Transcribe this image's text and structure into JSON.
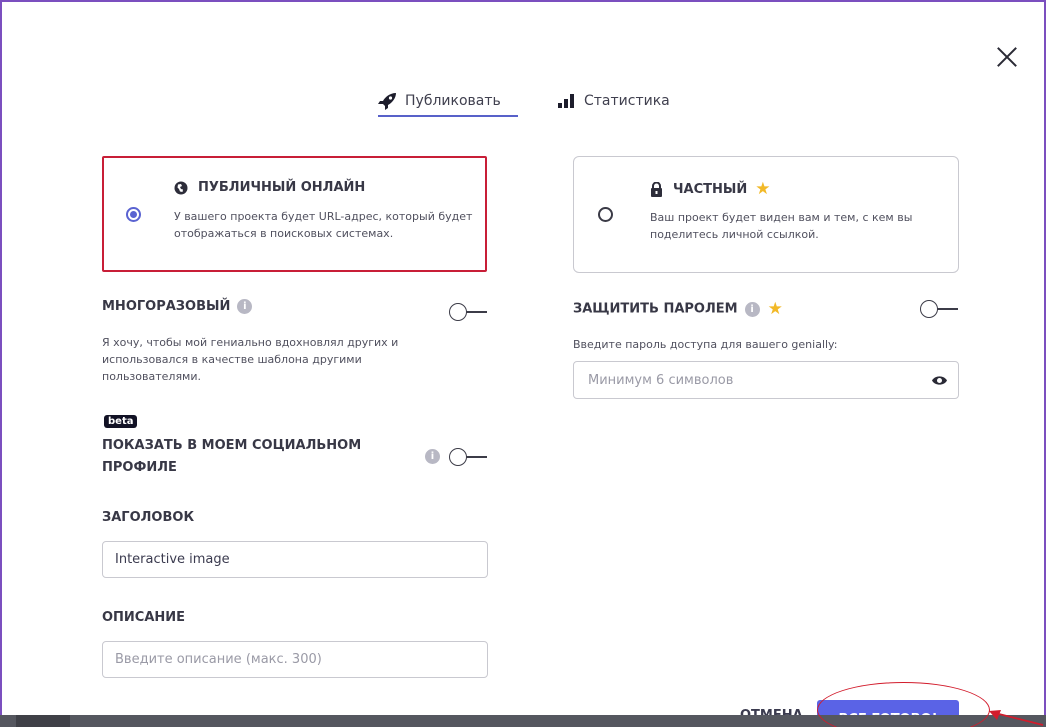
{
  "tabs": {
    "publish": "Публиковать",
    "stats": "Статистика"
  },
  "visibility": {
    "public": {
      "title": "ПУБЛИЧНЫЙ ОНЛАЙН",
      "description": "У вашего проекта будет URL-адрес, который будет отображаться в поисковых системах.",
      "selected": true
    },
    "private": {
      "title": "ЧАСТНЫЙ",
      "description": "Ваш проект будет виден вам и тем, с кем вы поделитесь личной ссылкой.",
      "selected": false
    }
  },
  "reusable": {
    "label": "МНОГОРАЗОВЫЙ",
    "description": "Я хочу, чтобы мой гениально вдохновлял других и использовался в качестве шаблона другими пользователями.",
    "enabled": false
  },
  "password": {
    "label": "ЗАЩИТИТЬ ПАРОЛЕМ",
    "description": "Введите пароль доступа для вашего genially:",
    "placeholder": "Минимум 6 символов",
    "enabled": false
  },
  "social": {
    "badge": "beta",
    "label": "ПОКАЗАТЬ В МОЕМ СОЦИАЛЬНОМ ПРОФИЛЕ",
    "enabled": false
  },
  "title_field": {
    "label": "ЗАГОЛОВОК",
    "value": "Interactive image"
  },
  "description_field": {
    "label": "ОПИСАНИЕ",
    "placeholder": "Введите описание (макс. 300)"
  },
  "footer": {
    "cancel": "ОТМЕНА",
    "done": "ВСЕ ГОТОВО!"
  },
  "colors": {
    "accent": "#5a63e6",
    "highlight": "#c81e37",
    "star": "#f2b928"
  },
  "icons": {
    "close": "close-icon",
    "publish": "rocket-icon",
    "stats": "bar-chart-icon",
    "public": "globe-icon",
    "private": "lock-icon",
    "info": "info-icon",
    "premium": "star-icon",
    "reveal": "eye-icon"
  }
}
